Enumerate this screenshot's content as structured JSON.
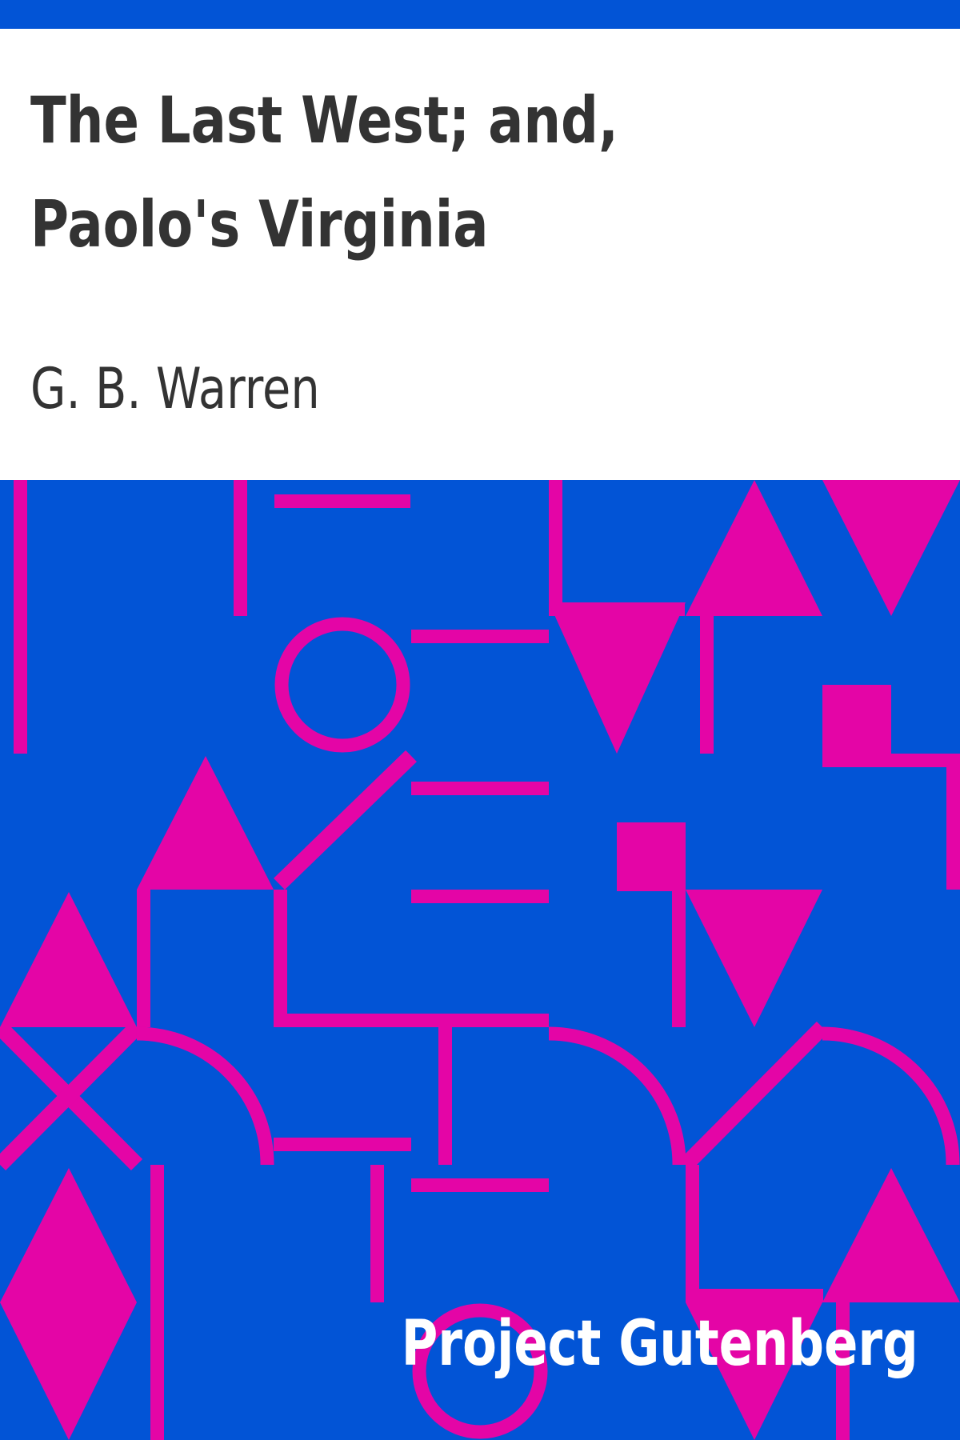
{
  "cover": {
    "title": "The Last West; and, Paolo's Virginia",
    "author": "G. B. Warren",
    "publisher": "Project Gutenberg"
  },
  "colors": {
    "background": "#ffffff",
    "band": "#0254d6",
    "shape": "#e405a6",
    "text": "#333333",
    "publisher_text": "#ffffff"
  }
}
